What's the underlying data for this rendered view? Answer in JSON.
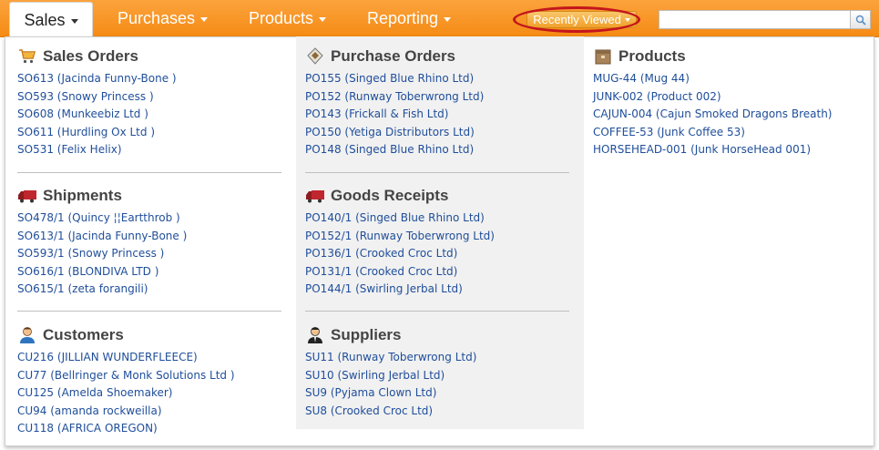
{
  "nav": {
    "tabs": [
      {
        "label": "Sales"
      },
      {
        "label": "Purchases"
      },
      {
        "label": "Products"
      },
      {
        "label": "Reporting"
      }
    ],
    "recent_label": "Recently Viewed",
    "search_placeholder": ""
  },
  "icons": {
    "sales": "shopping-cart-icon",
    "purchase": "tag-icon",
    "products": "box-icon",
    "shipments": "truck-icon",
    "goods": "truck-icon",
    "customers": "person-icon",
    "suppliers": "person-suit-icon",
    "search": "magnifier-icon"
  },
  "colors": {
    "accent": "#f7941d",
    "link": "#1f4e9a",
    "highlight_ring": "#c4161c"
  },
  "sales_orders": {
    "title": "Sales Orders",
    "items": [
      "SO613 (Jacinda Funny-Bone )",
      "SO593 (Snowy Princess )",
      "SO608 (Munkeebiz Ltd )",
      "SO611 (Hurdling Ox Ltd )",
      "SO531 (Felix Helix)"
    ]
  },
  "shipments": {
    "title": "Shipments",
    "items": [
      "SO478/1 (Quincy ¦¦Eartthrob )",
      "SO613/1 (Jacinda Funny-Bone )",
      "SO593/1 (Snowy Princess )",
      "SO616/1 (BLONDIVA LTD )",
      "SO615/1 (zeta forangili)"
    ]
  },
  "customers": {
    "title": "Customers",
    "items": [
      "CU216 (JILLIAN WUNDERFLEECE)",
      "CU77 (Bellringer & Monk Solutions Ltd )",
      "CU125 (Amelda Shoemaker)",
      "CU94 (amanda rockweilla)",
      "CU118 (AFRICA OREGON)"
    ]
  },
  "purchase_orders": {
    "title": "Purchase Orders",
    "items": [
      "PO155 (Singed Blue Rhino Ltd)",
      "PO152 (Runway Toberwrong Ltd)",
      "PO143 (Frickall & Fish Ltd)",
      "PO150 (Yetiga Distributors Ltd)",
      "PO148 (Singed Blue Rhino Ltd)"
    ]
  },
  "goods_receipts": {
    "title": "Goods Receipts",
    "items": [
      "PO140/1 (Singed Blue Rhino Ltd)",
      "PO152/1 (Runway Toberwrong Ltd)",
      "PO136/1 (Crooked Croc Ltd)",
      "PO131/1 (Crooked Croc Ltd)",
      "PO144/1 (Swirling Jerbal Ltd)"
    ]
  },
  "suppliers": {
    "title": "Suppliers",
    "items": [
      "SU11 (Runway Toberwrong Ltd)",
      "SU10 (Swirling Jerbal Ltd)",
      "SU9 (Pyjama Clown Ltd)",
      "SU8 (Crooked Croc Ltd)"
    ]
  },
  "products": {
    "title": "Products",
    "items": [
      "MUG-44 (Mug 44)",
      "JUNK-002 (Product 002)",
      "CAJUN-004 (Cajun Smoked Dragons Breath)",
      "COFFEE-53 (Junk Coffee 53)",
      "HORSEHEAD-001 (Junk HorseHead 001)"
    ]
  }
}
